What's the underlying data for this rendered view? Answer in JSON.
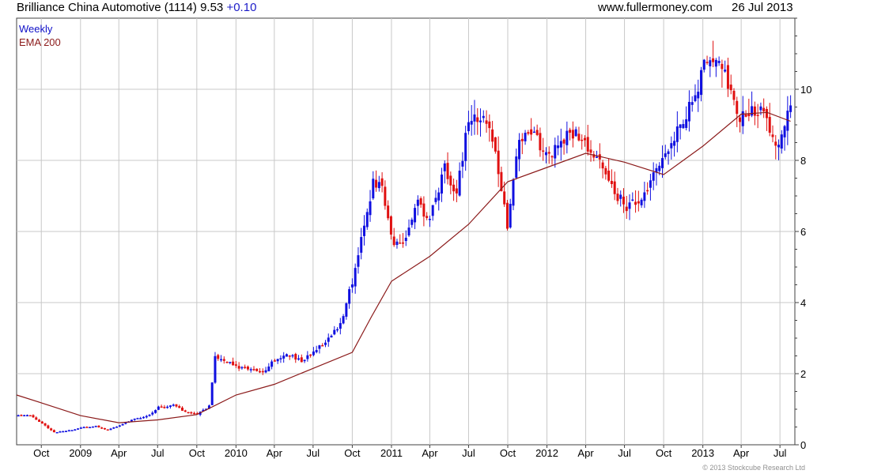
{
  "header": {
    "title": "Brilliance China Automotive (1114)",
    "price": "9.53",
    "change": "+0.10",
    "source": "www.fullermoney.com",
    "date": "26 Jul 2013"
  },
  "legend": {
    "weekly": "Weekly",
    "ema": "EMA 200"
  },
  "copyright": "© 2013 Stockcube Research Ltd",
  "colors": {
    "up": "#1010e0",
    "down": "#e01010",
    "ema": "#8b1a1a",
    "grid": "#c8c8c8",
    "axis": "#404040",
    "change": "#1c1cc8"
  },
  "chart_data": {
    "type": "candlestick",
    "title": "Brilliance China Automotive (1114) 9.53 +0.10",
    "period": "Weekly",
    "ylim": [
      0,
      12
    ],
    "yticks": [
      "0",
      "2",
      "4",
      "6",
      "8",
      "10"
    ],
    "grid": true,
    "legend_position": "top-left",
    "x_labels": [
      "Oct",
      "2009",
      "Apr",
      "Jul",
      "Oct",
      "2010",
      "Apr",
      "Jul",
      "Oct",
      "2011",
      "Apr",
      "Jul",
      "Oct",
      "2012",
      "Apr",
      "Jul",
      "Oct",
      "2013",
      "Apr",
      "Jul"
    ],
    "x_dates": [
      "2008-10-01",
      "2009-01-01",
      "2009-04-01",
      "2009-07-01",
      "2009-10-01",
      "2010-01-01",
      "2010-04-01",
      "2010-07-01",
      "2010-10-01",
      "2011-01-01",
      "2011-04-01",
      "2011-07-01",
      "2011-10-01",
      "2012-01-01",
      "2012-04-01",
      "2012-07-01",
      "2012-10-01",
      "2013-01-01",
      "2013-04-01",
      "2013-07-01"
    ],
    "x_range": [
      "2008-08-04",
      "2013-08-05"
    ],
    "series": [
      {
        "name": "Weekly",
        "kind": "close",
        "points": [
          [
            "2008-08-08",
            0.85
          ],
          [
            "2008-09-05",
            0.82
          ],
          [
            "2008-10-03",
            0.6
          ],
          [
            "2008-10-31",
            0.35
          ],
          [
            "2008-12-05",
            0.4
          ],
          [
            "2009-01-02",
            0.48
          ],
          [
            "2009-02-06",
            0.52
          ],
          [
            "2009-03-06",
            0.42
          ],
          [
            "2009-04-03",
            0.55
          ],
          [
            "2009-05-01",
            0.7
          ],
          [
            "2009-06-05",
            0.8
          ],
          [
            "2009-07-03",
            1.05
          ],
          [
            "2009-08-07",
            1.12
          ],
          [
            "2009-09-04",
            0.92
          ],
          [
            "2009-10-02",
            0.85
          ],
          [
            "2009-10-30",
            1.1
          ],
          [
            "2009-11-13",
            2.45
          ],
          [
            "2009-12-04",
            2.4
          ],
          [
            "2010-01-01",
            2.2
          ],
          [
            "2010-02-05",
            2.1
          ],
          [
            "2010-03-05",
            2.05
          ],
          [
            "2010-04-02",
            2.4
          ],
          [
            "2010-05-07",
            2.55
          ],
          [
            "2010-06-04",
            2.35
          ],
          [
            "2010-07-02",
            2.6
          ],
          [
            "2010-08-06",
            3.0
          ],
          [
            "2010-09-03",
            3.4
          ],
          [
            "2010-10-01",
            4.6
          ],
          [
            "2010-10-29",
            6.2
          ],
          [
            "2010-11-19",
            7.4
          ],
          [
            "2010-12-10",
            7.2
          ],
          [
            "2011-01-07",
            5.6
          ],
          [
            "2011-02-04",
            5.8
          ],
          [
            "2011-03-04",
            6.8
          ],
          [
            "2011-04-01",
            6.3
          ],
          [
            "2011-05-06",
            7.8
          ],
          [
            "2011-06-03",
            7.1
          ],
          [
            "2011-07-01",
            9.1
          ],
          [
            "2011-08-05",
            9.3
          ],
          [
            "2011-09-02",
            8.2
          ],
          [
            "2011-09-30",
            6.2
          ],
          [
            "2011-10-28",
            8.6
          ],
          [
            "2011-12-02",
            8.7
          ],
          [
            "2012-01-06",
            8.1
          ],
          [
            "2012-02-03",
            8.6
          ],
          [
            "2012-03-02",
            8.8
          ],
          [
            "2012-04-06",
            8.4
          ],
          [
            "2012-05-04",
            7.9
          ],
          [
            "2012-06-01",
            7.2
          ],
          [
            "2012-07-06",
            6.7
          ],
          [
            "2012-08-03",
            6.8
          ],
          [
            "2012-09-07",
            7.5
          ],
          [
            "2012-10-05",
            8.2
          ],
          [
            "2012-11-02",
            8.9
          ],
          [
            "2012-12-07",
            9.6
          ],
          [
            "2013-01-04",
            10.6
          ],
          [
            "2013-02-01",
            10.8
          ],
          [
            "2013-03-01",
            10.2
          ],
          [
            "2013-03-29",
            9.2
          ],
          [
            "2013-04-26",
            9.5
          ],
          [
            "2013-05-24",
            9.3
          ],
          [
            "2013-06-21",
            8.5
          ],
          [
            "2013-07-12",
            8.9
          ],
          [
            "2013-07-26",
            9.53
          ]
        ]
      },
      {
        "name": "EMA 200",
        "kind": "ema",
        "points": [
          [
            "2008-08-04",
            1.4
          ],
          [
            "2008-10-01",
            1.18
          ],
          [
            "2009-01-01",
            0.82
          ],
          [
            "2009-04-01",
            0.62
          ],
          [
            "2009-07-01",
            0.7
          ],
          [
            "2009-10-01",
            0.85
          ],
          [
            "2010-01-01",
            1.4
          ],
          [
            "2010-04-01",
            1.7
          ],
          [
            "2010-07-01",
            2.15
          ],
          [
            "2010-10-01",
            2.6
          ],
          [
            "2010-11-15",
            3.6
          ],
          [
            "2011-01-01",
            4.6
          ],
          [
            "2011-04-01",
            5.3
          ],
          [
            "2011-07-01",
            6.2
          ],
          [
            "2011-10-01",
            7.4
          ],
          [
            "2012-01-01",
            7.8
          ],
          [
            "2012-04-01",
            8.2
          ],
          [
            "2012-07-01",
            7.95
          ],
          [
            "2012-10-01",
            7.6
          ],
          [
            "2013-01-01",
            8.4
          ],
          [
            "2013-04-01",
            9.3
          ],
          [
            "2013-06-01",
            9.35
          ],
          [
            "2013-07-26",
            9.1
          ]
        ]
      }
    ]
  }
}
